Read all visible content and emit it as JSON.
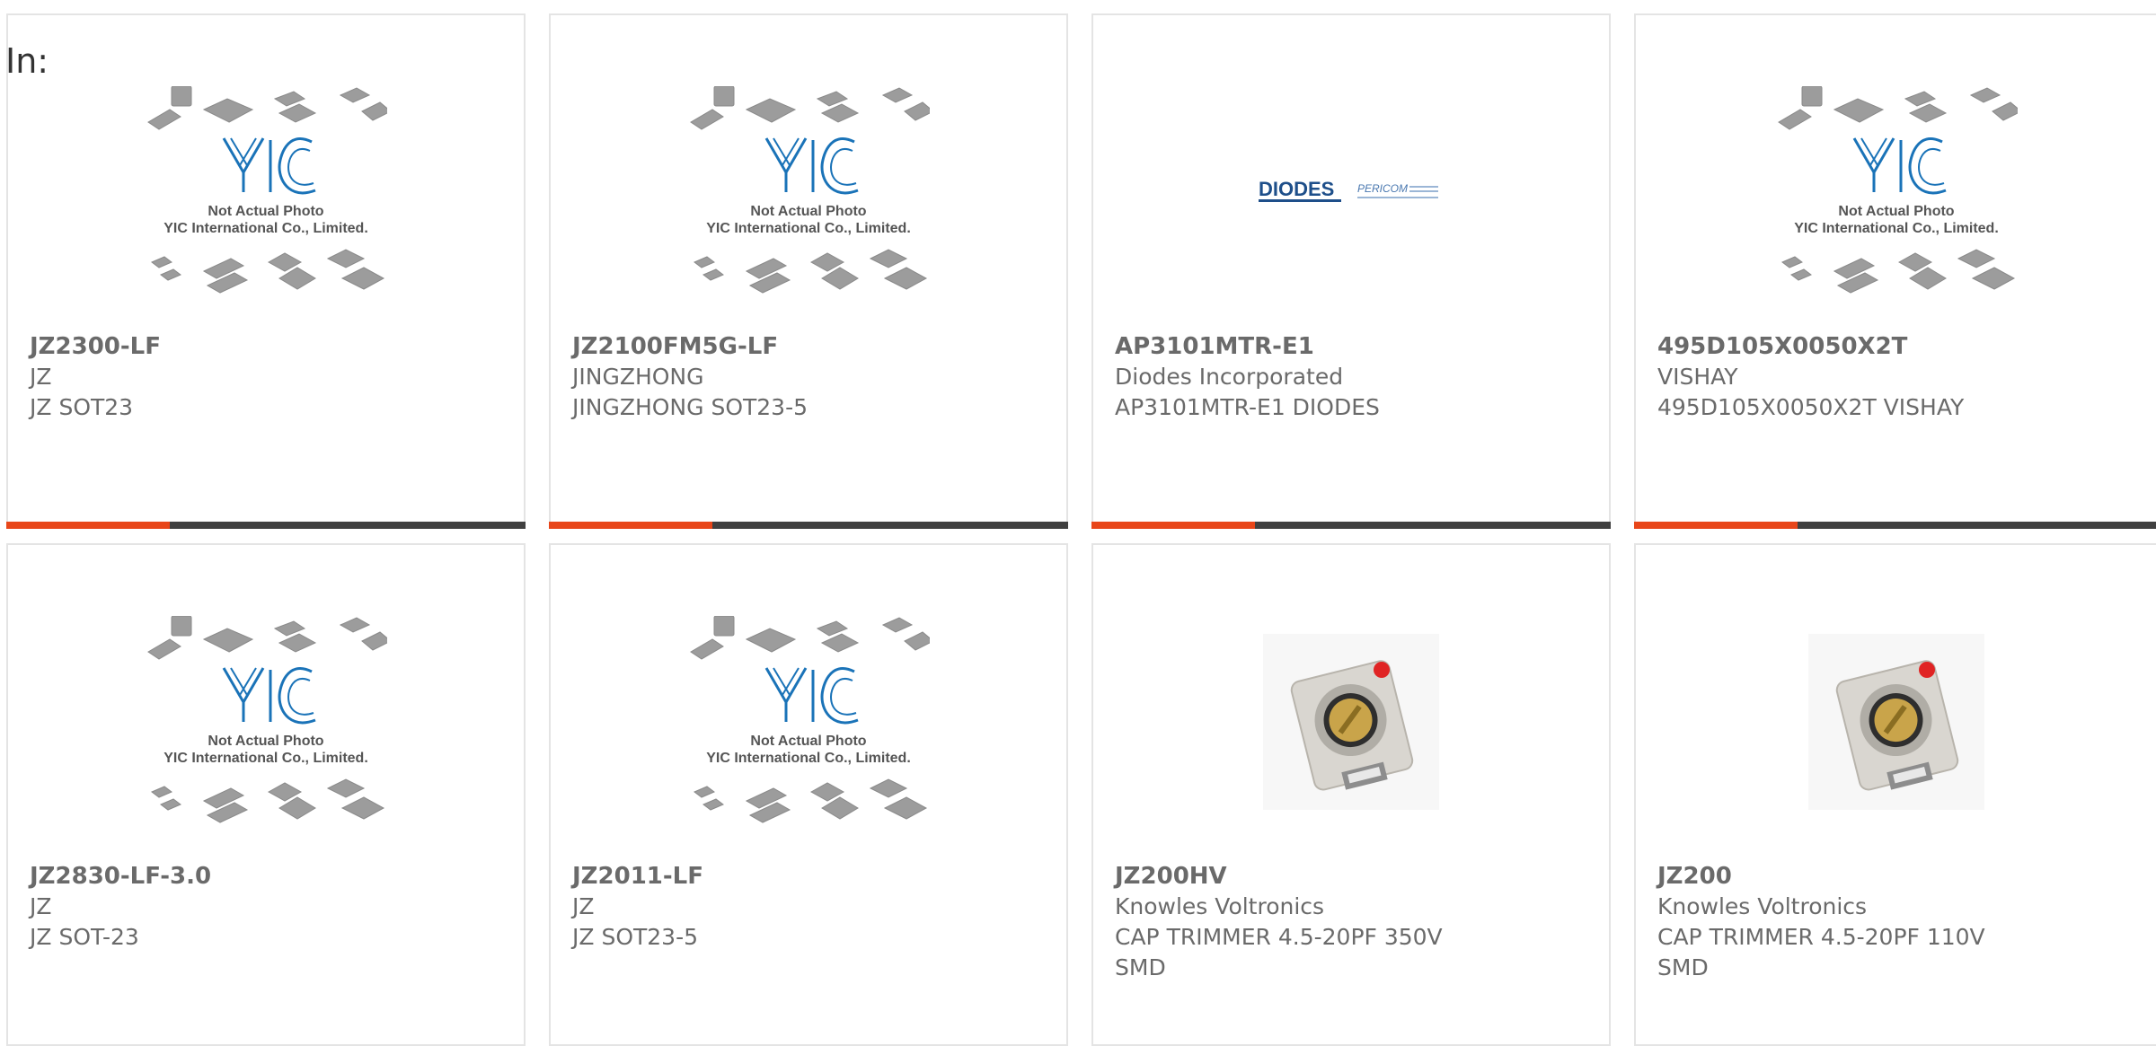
{
  "in_label": "In:",
  "placeholder_image": {
    "caption_line1": "Not Actual Photo",
    "caption_line2": "YIC International Co., Limited.",
    "logo": "YIC"
  },
  "diodes_logo": {
    "brand": "DIODES",
    "subbrand": "PERICOM"
  },
  "colors": {
    "accent": "#e8461a",
    "bar_dark": "#404040",
    "yic_blue": "#1a73b8"
  },
  "products": [
    {
      "part_number": "JZ2300-LF",
      "manufacturer": "JZ",
      "description": "JZ SOT23",
      "image": "yic-placeholder"
    },
    {
      "part_number": "JZ2100FM5G-LF",
      "manufacturer": "JINGZHONG",
      "description": "JINGZHONG SOT23-5",
      "image": "yic-placeholder"
    },
    {
      "part_number": "AP3101MTR-E1",
      "manufacturer": "Diodes Incorporated",
      "description": "AP3101MTR-E1 DIODES",
      "image": "diodes-logo"
    },
    {
      "part_number": "495D105X0050X2T",
      "manufacturer": "VISHAY",
      "description": "495D105X0050X2T VISHAY",
      "image": "yic-placeholder"
    },
    {
      "part_number": "JZ2830-LF-3.0",
      "manufacturer": "JZ",
      "description": "JZ SOT-23",
      "image": "yic-placeholder"
    },
    {
      "part_number": "JZ2011-LF",
      "manufacturer": "JZ",
      "description": "JZ SOT23-5",
      "image": "yic-placeholder"
    },
    {
      "part_number": "JZ200HV",
      "manufacturer": "Knowles Voltronics",
      "description": "CAP TRIMMER 4.5-20PF 350V SMD",
      "image": "trimmer-capacitor"
    },
    {
      "part_number": "JZ200",
      "manufacturer": "Knowles Voltronics",
      "description": "CAP TRIMMER 4.5-20PF 110V SMD",
      "image": "trimmer-capacitor"
    }
  ]
}
